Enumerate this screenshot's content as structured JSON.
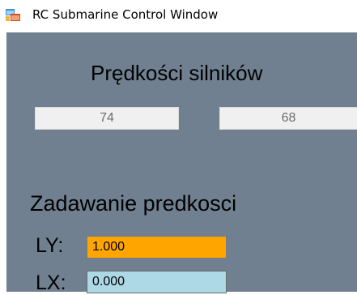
{
  "window": {
    "title": "RC Submarine Control Window",
    "icon": "app-window-icon"
  },
  "motor_speeds": {
    "heading": "Prędkości silników",
    "left_value": "74",
    "right_value": "68"
  },
  "speed_setting": {
    "heading": "Zadawanie predkosci",
    "ly_label": "LY:",
    "ly_value": "1.000",
    "lx_label": "LX:",
    "lx_value": "0.000"
  },
  "colors": {
    "panel_background": "#708090",
    "ly_field": "#ffa500",
    "lx_field": "#add8e6"
  }
}
